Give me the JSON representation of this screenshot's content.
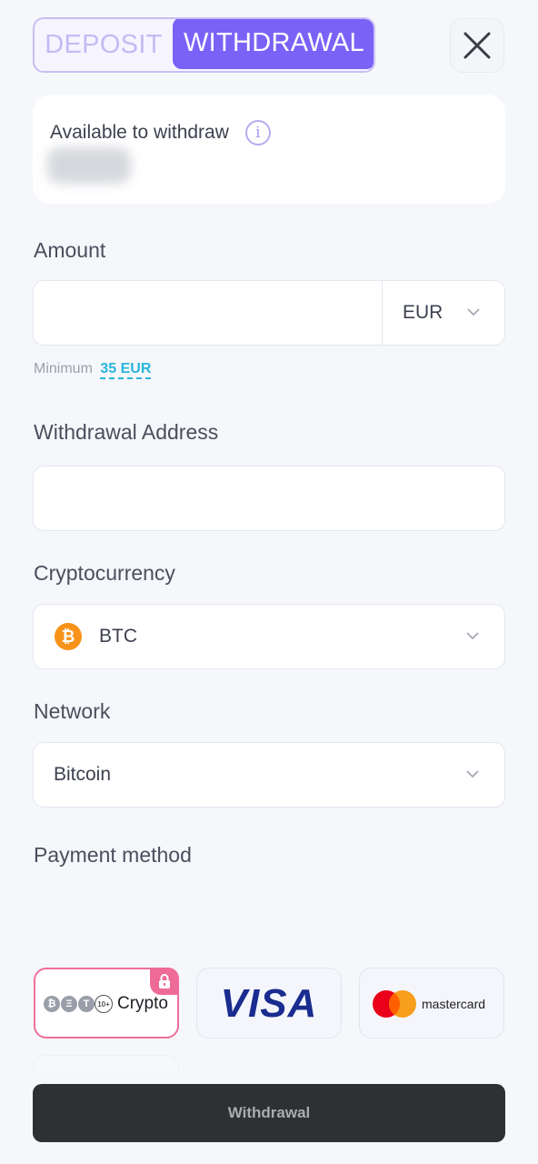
{
  "tabs": {
    "deposit": "DEPOSIT",
    "withdrawal": "WITHDRAWAL"
  },
  "balance": {
    "label": "Available to withdraw",
    "info_icon": "i"
  },
  "amount": {
    "label": "Amount",
    "value": "",
    "currency": "EUR",
    "minimum_label": "Minimum",
    "minimum_value": "35 EUR"
  },
  "address": {
    "label": "Withdrawal Address",
    "value": ""
  },
  "cryptocurrency": {
    "label": "Cryptocurrency",
    "selected": "BTC",
    "icon": "bitcoin-icon"
  },
  "network": {
    "label": "Network",
    "selected": "Bitcoin"
  },
  "payment": {
    "label": "Payment method",
    "methods": [
      {
        "name": "Crypto",
        "coins": [
          "₿",
          "Ξ",
          "T",
          "10+"
        ],
        "selected": true,
        "locked": true
      },
      {
        "name": "VISA"
      },
      {
        "name": "mastercard"
      }
    ]
  },
  "submit_label": "Withdrawal",
  "colors": {
    "accent": "#7a62f7",
    "selected_border": "#ef6f9a",
    "link": "#2bb5d9",
    "button": "#2d3134"
  }
}
